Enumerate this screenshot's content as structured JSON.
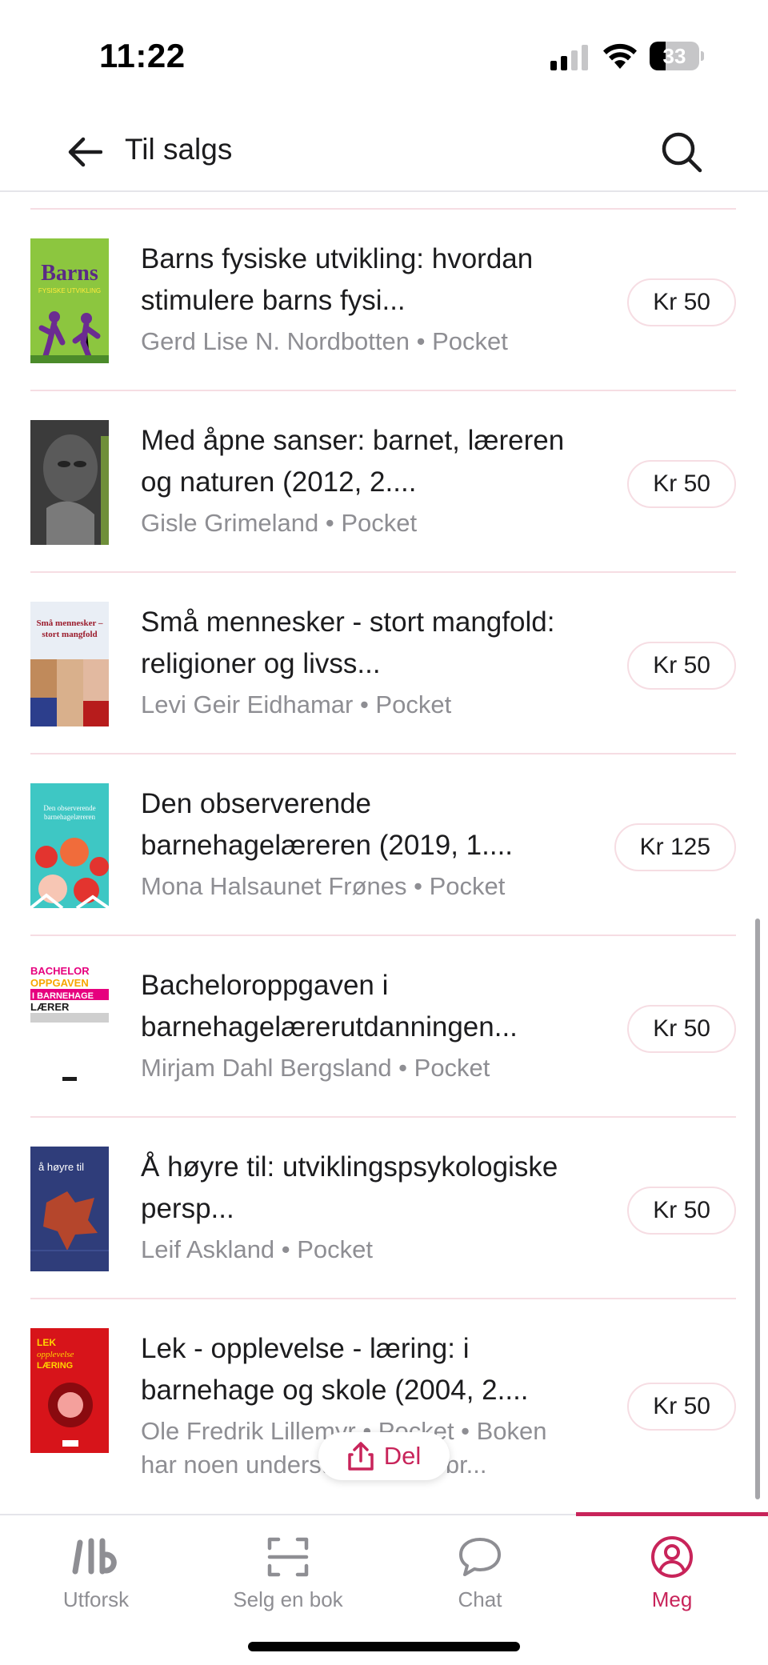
{
  "status_bar": {
    "time": "11:22",
    "battery": "33",
    "battery_level": 0.33
  },
  "header": {
    "title": "Til salgs",
    "back_icon": "arrow-left-icon",
    "search_icon": "search-icon"
  },
  "books": [
    {
      "title": "Barns fysiske utvikling: hvordan stimulere barns fysi...",
      "meta": "Gerd Lise N. Nordbotten • Pocket",
      "price": "Kr 50",
      "cover": {
        "bg": "#8cc63f",
        "text": "Barns",
        "subtext": "FYSISKE UTVIKLING",
        "text_color": "#5a2a86",
        "accent": "#6b2c91"
      }
    },
    {
      "title": "Med åpne sanser: barnet, læreren og naturen (2012, 2....",
      "meta": "Gisle Grimeland • Pocket",
      "price": "Kr 50",
      "cover": {
        "bg": "#3b3b3b",
        "accent": "#8c8c8c"
      }
    },
    {
      "title": "Små mennesker - stort mangfold: religioner og livss...",
      "meta": "Levi Geir Eidhamar • Pocket",
      "price": "Kr 50",
      "cover": {
        "bg": "#e9eef5",
        "text": "Små mennesker – stort mangfold",
        "text_color": "#9b1c2c",
        "accent": "#2c3e8c"
      }
    },
    {
      "title": "Den observerende barnehagelæreren (2019, 1....",
      "meta": "Mona Halsaunet Frønes • Pocket",
      "price": "Kr 125",
      "cover": {
        "bg": "#3ec7c4",
        "text": "Den observerende barnehagelæreren",
        "text_color": "#ffffff",
        "accent": "#e3342f"
      }
    },
    {
      "title": "Bacheloroppgaven i barnehagelærerutdanningen...",
      "meta": "Mirjam Dahl Bergsland • Pocket",
      "price": "Kr 50",
      "cover": {
        "bg": "#ffffff",
        "text": "BACHELOR OPPGAVEN I BARNEHAGE LÆRER",
        "text_color": "#e6007e",
        "accent": "#1c1c1c"
      }
    },
    {
      "title": "Å høyre til: utviklingspsykologiske persp...",
      "meta": "Leif Askland • Pocket",
      "price": "Kr 50",
      "cover": {
        "bg": "#2f3d7a",
        "text": "å høyre til",
        "text_color": "#ffffff",
        "accent": "#b5462c"
      }
    },
    {
      "title": "Lek - opplevelse - læring: i barnehage og skole (2004, 2....",
      "meta": "Ole Fredrik Lillemyr • Pocket • Boken har noen understreker eller br...",
      "price": "Kr 50",
      "cover": {
        "bg": "#d7141a",
        "text": "LEK opplevelse LÆRING",
        "text_color": "#ffd400",
        "accent": "#8a0a0f"
      }
    }
  ],
  "share": {
    "label": "Del",
    "icon": "share-icon"
  },
  "tabs": [
    {
      "label": "Utforsk",
      "icon": "lb-logo-icon",
      "active": false
    },
    {
      "label": "Selg en bok",
      "icon": "scan-icon",
      "active": false
    },
    {
      "label": "Chat",
      "icon": "chat-bubble-icon",
      "active": false
    },
    {
      "label": "Meg",
      "icon": "user-circle-icon",
      "active": true
    }
  ],
  "colors": {
    "accent": "#c8245a",
    "divider": "#f6dde3",
    "muted_text": "#8e8e93"
  }
}
